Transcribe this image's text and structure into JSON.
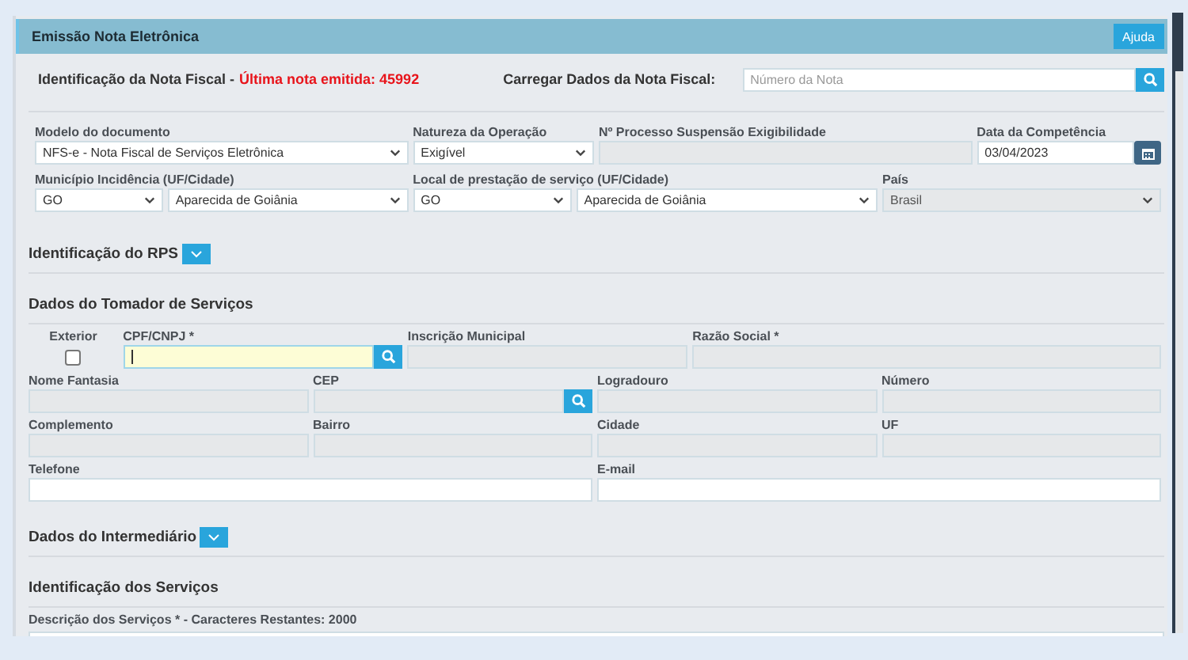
{
  "window": {
    "title": "Emissão Nota Eletrônica",
    "help_button": "Ajuda"
  },
  "invoice_header": {
    "label": "Identificação da Nota Fiscal -",
    "last_note": "Última nota emitida: 45992",
    "load_label": "Carregar Dados da Nota Fiscal:",
    "load_field": {
      "placeholder": "Número da Nota"
    }
  },
  "document_rows": [
    [
      {
        "label": "Modelo do documento",
        "controls": [
          {
            "kind": "select",
            "value": "NFS-e - Nota Fiscal de Serviços Eletrônica",
            "disabled": false
          }
        ]
      },
      {
        "label": "Natureza da Operação",
        "controls": [
          {
            "kind": "select",
            "value": "Exigível",
            "disabled": false
          }
        ]
      },
      {
        "label": "Nº Processo Suspensão Exigibilidade",
        "controls": [
          {
            "kind": "text",
            "disabled": true
          }
        ]
      },
      {
        "label": "Data da Competência",
        "controls": [
          {
            "kind": "date",
            "value": "03/04/2023",
            "disabled": false
          }
        ]
      }
    ],
    [
      {
        "label": "Município Incidência (UF/Cidade)",
        "controls": [
          {
            "kind": "select",
            "value": "GO",
            "disabled": false
          },
          {
            "kind": "select",
            "value": "Aparecida de Goiânia",
            "disabled": false
          }
        ]
      },
      {
        "label": "Local de prestação de serviço (UF/Cidade)",
        "controls": [
          {
            "kind": "select",
            "value": "GO",
            "disabled": false
          },
          {
            "kind": "select",
            "value": "Aparecida de Goiânia",
            "disabled": false
          }
        ]
      },
      {
        "label": "País",
        "controls": [
          {
            "kind": "select",
            "value": "Brasil",
            "disabled": true
          }
        ]
      }
    ]
  ],
  "rps_section": {
    "title": "Identificação do RPS",
    "expanded": false
  },
  "tomador_section": {
    "title": "Dados do Tomador de Serviços",
    "rows": [
      [
        {
          "label": "Exterior",
          "controls": [
            {
              "kind": "checkbox",
              "checked": false
            }
          ]
        },
        {
          "label": "CPF/CNPJ *",
          "controls": [
            {
              "kind": "search",
              "disabled": false,
              "focused": true
            }
          ]
        },
        {
          "label": "Inscrição Municipal",
          "controls": [
            {
              "kind": "text",
              "disabled": true
            }
          ]
        },
        {
          "label": "Razão Social *",
          "controls": [
            {
              "kind": "text",
              "disabled": true
            }
          ]
        }
      ],
      [
        {
          "label": "Nome Fantasia",
          "controls": [
            {
              "kind": "text",
              "disabled": true
            }
          ]
        },
        {
          "label": "CEP",
          "controls": [
            {
              "kind": "search",
              "disabled": true,
              "focused": false
            }
          ]
        },
        {
          "label": "Logradouro",
          "controls": [
            {
              "kind": "text",
              "disabled": true
            }
          ]
        },
        {
          "label": "Número",
          "controls": [
            {
              "kind": "text",
              "disabled": true
            }
          ]
        }
      ],
      [
        {
          "label": "Complemento",
          "controls": [
            {
              "kind": "text",
              "disabled": true
            }
          ]
        },
        {
          "label": "Bairro",
          "controls": [
            {
              "kind": "text",
              "disabled": true
            }
          ]
        },
        {
          "label": "Cidade",
          "controls": [
            {
              "kind": "text",
              "disabled": true
            }
          ]
        },
        {
          "label": "UF",
          "controls": [
            {
              "kind": "text",
              "disabled": true
            }
          ]
        }
      ]
    ],
    "contact_fields": [
      {
        "label": "Telefone",
        "kind": "text",
        "disabled": false
      },
      {
        "label": "E-mail",
        "kind": "text",
        "disabled": false
      }
    ]
  },
  "intermediary_section": {
    "title": "Dados do Intermediário",
    "expanded": false
  },
  "services_section": {
    "title": "Identificação dos Serviços",
    "description_label": "Descrição dos Serviços * - Caracteres Restantes: 2000"
  }
}
